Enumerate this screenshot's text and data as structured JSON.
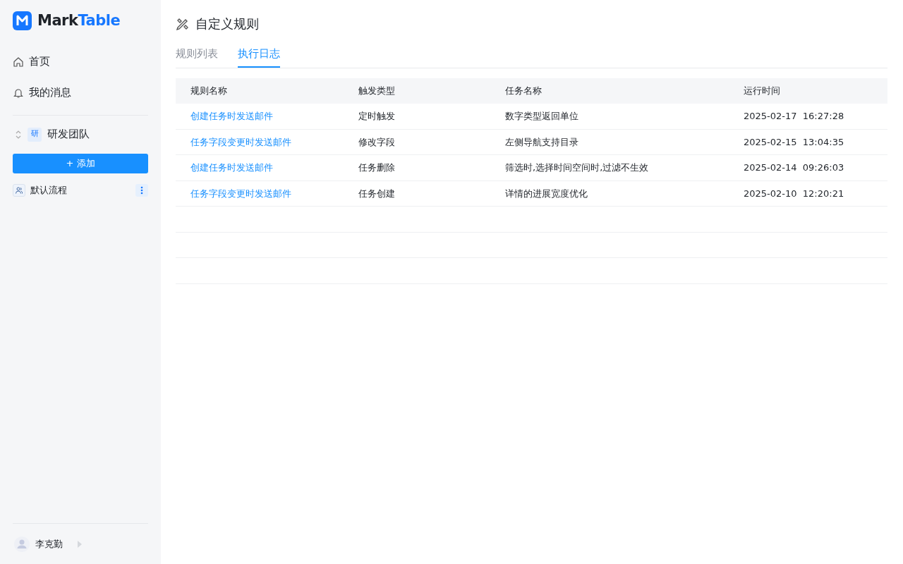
{
  "logo": {
    "text_dark": "Mark",
    "text_blue": "Table"
  },
  "nav": [
    {
      "kind": "home",
      "label": "首页"
    },
    {
      "kind": "bell",
      "label": "我的消息"
    }
  ],
  "team": {
    "badge": "研",
    "name": "研发团队"
  },
  "add_button": "+ 添加",
  "flows": [
    {
      "label": "默认流程"
    }
  ],
  "user": {
    "name": "李克勤"
  },
  "page": {
    "title": "自定义规则"
  },
  "tabs": [
    {
      "label": "规则列表",
      "selected": false
    },
    {
      "label": "执行日志",
      "selected": true
    }
  ],
  "table": {
    "columns": [
      "规则名称",
      "触发类型",
      "任务名称",
      "运行时间"
    ],
    "rows": [
      [
        "创建任务时发送邮件",
        "定时触发",
        "数字类型返回单位",
        "2025-02-17  16:27:28"
      ],
      [
        "任务字段变更时发送邮件",
        "修改字段",
        "左侧导航支持目录",
        "2025-02-15  13:04:35"
      ],
      [
        "创建任务时发送邮件",
        "任务删除",
        "筛选时,选择时间空间时,过滤不生效",
        "2025-02-14  09:26:03"
      ],
      [
        "任务字段变更时发送邮件",
        "任务创建",
        "详情的进展宽度优化",
        "2025-02-10  12:20:21"
      ]
    ]
  }
}
